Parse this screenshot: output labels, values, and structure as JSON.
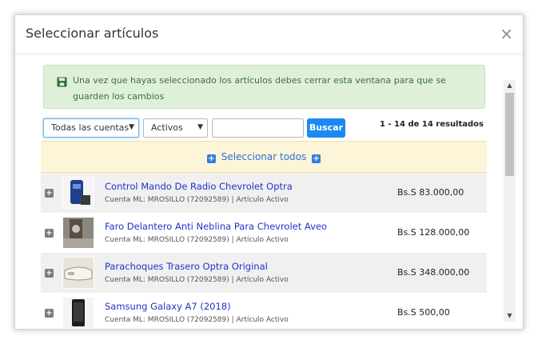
{
  "modal": {
    "title": "Seleccionar artículos",
    "close_label": "×"
  },
  "alert": {
    "text": "Una vez que hayas seleccionado los artículos debes cerrar esta ventana para que se guarden los cambios"
  },
  "filters": {
    "accounts_value": "Todas las cuentas",
    "status_value": "Activos",
    "search_value": "",
    "search_button": "Buscar",
    "results_text": "1 - 14 de 14 resultados"
  },
  "select_all": {
    "label": "Seleccionar todos"
  },
  "items": [
    {
      "title": "Control Mando De Radio Chevrolet Optra",
      "meta": "Cuenta ML: MROSILLO (72092589) | Artículo Activo",
      "price": "Bs.S 83.000,00"
    },
    {
      "title": "Faro Delantero Anti Neblina Para Chevrolet Aveo",
      "meta": "Cuenta ML: MROSILLO (72092589) | Artículo Activo",
      "price": "Bs.S 128.000,00"
    },
    {
      "title": "Parachoques Trasero Optra Original",
      "meta": "Cuenta ML: MROSILLO (72092589) | Artículo Activo",
      "price": "Bs.S 348.000,00"
    },
    {
      "title": "Samsung Galaxy A7 (2018)",
      "meta": "Cuenta ML: MROSILLO (72092589) | Artículo Activo",
      "price": "Bs.S 500,00"
    }
  ],
  "colors": {
    "accent": "#1a8af0",
    "alert_bg": "#dff0d8",
    "select_all_bg": "#fcf5d8",
    "link": "#1d34c9"
  }
}
